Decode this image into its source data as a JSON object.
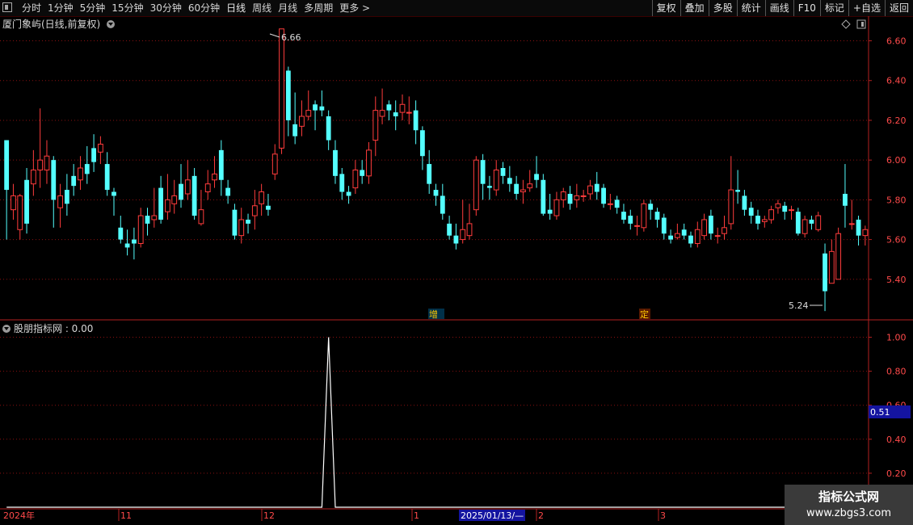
{
  "toolbar": {
    "tabs": [
      {
        "label": "分时"
      },
      {
        "label": "1分钟"
      },
      {
        "label": "5分钟"
      },
      {
        "label": "15分钟"
      },
      {
        "label": "30分钟"
      },
      {
        "label": "60分钟"
      },
      {
        "label": "日线",
        "active": true
      },
      {
        "label": "周线"
      },
      {
        "label": "月线"
      },
      {
        "label": "多周期"
      },
      {
        "label": "更多 >"
      }
    ],
    "right_buttons": [
      {
        "label": "复权"
      },
      {
        "label": "叠加"
      },
      {
        "label": "多股"
      },
      {
        "label": "统计"
      },
      {
        "label": "画线"
      },
      {
        "label": "F10"
      },
      {
        "label": "标记"
      },
      {
        "label": "+自选"
      },
      {
        "label": "返回"
      }
    ]
  },
  "main_panel": {
    "title": "厦门象屿(日线,前复权)",
    "max_label": "6.66",
    "min_label": "5.24",
    "marker_zeng": "增",
    "marker_ding": "定"
  },
  "indicator_panel": {
    "title": "股朋指标网 : 0.00",
    "current_value": "0.51"
  },
  "time_axis": {
    "labels": [
      "2024年",
      "11",
      "12",
      "1",
      "2",
      "3"
    ],
    "cursor_date": "2025/01/13/—"
  },
  "watermark": {
    "line1": "指标公式网",
    "line2": "www.zbgs3.com"
  },
  "colors": {
    "up": "#ff3c3c",
    "down": "#54ffff",
    "grid": "#8a1010",
    "border": "#b42020",
    "axis_text": "#ff4a4a",
    "value_box": "#1414a0"
  },
  "chart_data": [
    {
      "type": "candlestick",
      "title": "厦门象屿(日线,前复权)",
      "ylim": [
        5.2,
        6.72
      ],
      "yticks": [
        5.4,
        5.6,
        5.8,
        6.0,
        6.2,
        6.4,
        6.6
      ],
      "xlabels": [
        "2024年",
        "11",
        "12",
        "1",
        "2",
        "3"
      ],
      "annotations": [
        {
          "text": "6.66",
          "value": 6.66
        },
        {
          "text": "5.24",
          "value": 5.24
        }
      ],
      "candles": [
        [
          6.1,
          5.85,
          6.1,
          5.6
        ],
        [
          5.75,
          5.82,
          5.88,
          5.7
        ],
        [
          5.65,
          5.82,
          5.83,
          5.6
        ],
        [
          5.9,
          5.68,
          5.96,
          5.63
        ],
        [
          5.88,
          5.95,
          6.05,
          5.82
        ],
        [
          5.95,
          6.0,
          6.26,
          5.86
        ],
        [
          5.95,
          6.02,
          6.1,
          5.88
        ],
        [
          6.0,
          5.8,
          6.02,
          5.66
        ],
        [
          5.76,
          5.82,
          5.88,
          5.66
        ],
        [
          5.85,
          5.78,
          5.93,
          5.72
        ],
        [
          5.92,
          5.87,
          5.98,
          5.82
        ],
        [
          5.9,
          5.96,
          6.02,
          5.85
        ],
        [
          5.98,
          5.93,
          6.07,
          5.88
        ],
        [
          6.06,
          5.99,
          6.13,
          5.94
        ],
        [
          6.04,
          6.08,
          6.12,
          5.98
        ],
        [
          5.98,
          5.85,
          6.04,
          5.82
        ],
        [
          5.84,
          5.82,
          5.86,
          5.72
        ],
        [
          5.66,
          5.6,
          5.72,
          5.58
        ],
        [
          5.58,
          5.56,
          5.65,
          5.52
        ],
        [
          5.6,
          5.58,
          5.66,
          5.5
        ],
        [
          5.58,
          5.72,
          5.76,
          5.56
        ],
        [
          5.72,
          5.68,
          5.76,
          5.62
        ],
        [
          5.7,
          5.72,
          5.86,
          5.66
        ],
        [
          5.86,
          5.7,
          5.92,
          5.68
        ],
        [
          5.74,
          5.8,
          5.93,
          5.7
        ],
        [
          5.78,
          5.82,
          5.9,
          5.73
        ],
        [
          5.88,
          5.8,
          5.98,
          5.76
        ],
        [
          5.83,
          5.9,
          6.0,
          5.8
        ],
        [
          5.92,
          5.72,
          5.96,
          5.7
        ],
        [
          5.68,
          5.75,
          5.85,
          5.67
        ],
        [
          5.84,
          5.88,
          5.95,
          5.8
        ],
        [
          5.9,
          5.93,
          6.02,
          5.86
        ],
        [
          6.05,
          5.9,
          6.1,
          5.82
        ],
        [
          5.86,
          5.82,
          5.9,
          5.78
        ],
        [
          5.75,
          5.62,
          5.78,
          5.6
        ],
        [
          5.62,
          5.7,
          5.76,
          5.58
        ],
        [
          5.7,
          5.68,
          5.73,
          5.63
        ],
        [
          5.72,
          5.77,
          5.85,
          5.65
        ],
        [
          5.78,
          5.84,
          5.88,
          5.72
        ],
        [
          5.77,
          5.75,
          5.83,
          5.72
        ],
        [
          5.93,
          6.03,
          6.08,
          5.9
        ],
        [
          6.06,
          6.66,
          6.66,
          6.03
        ],
        [
          6.45,
          6.2,
          6.47,
          6.12
        ],
        [
          6.18,
          6.12,
          6.34,
          6.08
        ],
        [
          6.17,
          6.22,
          6.3,
          6.12
        ],
        [
          6.22,
          6.25,
          6.35,
          6.2
        ],
        [
          6.28,
          6.25,
          6.3,
          6.15
        ],
        [
          6.27,
          6.25,
          6.35,
          6.22
        ],
        [
          6.22,
          6.1,
          6.25,
          6.05
        ],
        [
          6.05,
          5.92,
          6.1,
          5.88
        ],
        [
          5.93,
          5.84,
          5.96,
          5.8
        ],
        [
          5.84,
          5.82,
          5.87,
          5.78
        ],
        [
          5.86,
          5.95,
          6.0,
          5.83
        ],
        [
          5.95,
          5.92,
          6.0,
          5.88
        ],
        [
          5.92,
          6.05,
          6.09,
          5.88
        ],
        [
          6.1,
          6.25,
          6.32,
          6.02
        ],
        [
          6.22,
          6.25,
          6.36,
          6.18
        ],
        [
          6.28,
          6.25,
          6.3,
          6.2
        ],
        [
          6.24,
          6.22,
          6.3,
          6.15
        ],
        [
          6.24,
          6.28,
          6.33,
          6.2
        ],
        [
          6.24,
          6.24,
          6.32,
          6.18
        ],
        [
          6.25,
          6.15,
          6.3,
          6.08
        ],
        [
          6.15,
          6.02,
          6.17,
          5.95
        ],
        [
          5.98,
          5.88,
          6.05,
          5.83
        ],
        [
          5.85,
          5.82,
          5.88,
          5.77
        ],
        [
          5.82,
          5.73,
          5.88,
          5.7
        ],
        [
          5.68,
          5.62,
          5.72,
          5.6
        ],
        [
          5.62,
          5.58,
          5.68,
          5.55
        ],
        [
          5.6,
          5.65,
          5.8,
          5.58
        ],
        [
          5.62,
          5.68,
          5.78,
          5.6
        ],
        [
          5.75,
          6.0,
          6.02,
          5.72
        ],
        [
          6.0,
          5.88,
          6.03,
          5.8
        ],
        [
          5.87,
          5.86,
          5.92,
          5.8
        ],
        [
          5.85,
          5.95,
          6.0,
          5.82
        ],
        [
          5.96,
          5.92,
          5.99,
          5.88
        ],
        [
          5.91,
          5.88,
          5.97,
          5.84
        ],
        [
          5.88,
          5.83,
          5.92,
          5.8
        ],
        [
          5.84,
          5.85,
          5.9,
          5.78
        ],
        [
          5.86,
          5.88,
          5.95,
          5.84
        ],
        [
          5.93,
          5.9,
          6.02,
          5.86
        ],
        [
          5.9,
          5.73,
          5.93,
          5.72
        ],
        [
          5.75,
          5.73,
          5.83,
          5.7
        ],
        [
          5.72,
          5.8,
          5.84,
          5.7
        ],
        [
          5.8,
          5.84,
          5.86,
          5.76
        ],
        [
          5.83,
          5.78,
          5.87,
          5.75
        ],
        [
          5.8,
          5.82,
          5.88,
          5.76
        ],
        [
          5.82,
          5.82,
          5.85,
          5.79
        ],
        [
          5.83,
          5.87,
          5.9,
          5.8
        ],
        [
          5.88,
          5.84,
          5.94,
          5.8
        ],
        [
          5.86,
          5.78,
          5.88,
          5.76
        ],
        [
          5.78,
          5.78,
          5.83,
          5.75
        ],
        [
          5.8,
          5.76,
          5.82,
          5.73
        ],
        [
          5.74,
          5.7,
          5.78,
          5.68
        ],
        [
          5.72,
          5.68,
          5.75,
          5.65
        ],
        [
          5.67,
          5.67,
          5.72,
          5.62
        ],
        [
          5.66,
          5.78,
          5.8,
          5.64
        ],
        [
          5.78,
          5.75,
          5.8,
          5.7
        ],
        [
          5.74,
          5.7,
          5.76,
          5.66
        ],
        [
          5.71,
          5.63,
          5.73,
          5.6
        ],
        [
          5.62,
          5.6,
          5.65,
          5.58
        ],
        [
          5.61,
          5.63,
          5.68,
          5.6
        ],
        [
          5.65,
          5.62,
          5.68,
          5.6
        ],
        [
          5.62,
          5.58,
          5.64,
          5.56
        ],
        [
          5.58,
          5.65,
          5.69,
          5.56
        ],
        [
          5.62,
          5.7,
          5.73,
          5.6
        ],
        [
          5.72,
          5.63,
          5.75,
          5.6
        ],
        [
          5.62,
          5.62,
          5.66,
          5.58
        ],
        [
          5.63,
          5.66,
          5.72,
          5.6
        ],
        [
          5.68,
          5.85,
          6.02,
          5.65
        ],
        [
          5.85,
          5.84,
          5.95,
          5.78
        ],
        [
          5.82,
          5.75,
          5.85,
          5.72
        ],
        [
          5.76,
          5.72,
          5.79,
          5.68
        ],
        [
          5.72,
          5.68,
          5.75,
          5.65
        ],
        [
          5.69,
          5.7,
          5.72,
          5.66
        ],
        [
          5.7,
          5.75,
          5.77,
          5.68
        ],
        [
          5.76,
          5.78,
          5.8,
          5.73
        ],
        [
          5.77,
          5.74,
          5.79,
          5.7
        ],
        [
          5.75,
          5.75,
          5.77,
          5.7
        ],
        [
          5.74,
          5.63,
          5.76,
          5.62
        ],
        [
          5.63,
          5.7,
          5.72,
          5.61
        ],
        [
          5.7,
          5.68,
          5.72,
          5.65
        ],
        [
          5.65,
          5.72,
          5.74,
          5.64
        ],
        [
          5.53,
          5.34,
          5.58,
          5.24
        ],
        [
          5.38,
          5.54,
          5.6,
          5.38
        ],
        [
          5.4,
          5.63,
          5.66,
          5.4
        ],
        [
          5.83,
          5.77,
          5.98,
          5.66
        ],
        [
          5.68,
          5.68,
          5.8,
          5.65
        ],
        [
          5.7,
          5.62,
          5.72,
          5.57
        ],
        [
          5.62,
          5.65,
          5.67,
          5.57
        ]
      ]
    },
    {
      "type": "line",
      "title": "股朋指标网 : 0.00",
      "ylim": [
        0,
        1.05
      ],
      "yticks": [
        0.2,
        0.4,
        0.6,
        0.8,
        1.0
      ],
      "series": [
        {
          "values": [
            0,
            0,
            0,
            0,
            0,
            0,
            0,
            0,
            0,
            0,
            0,
            0,
            0,
            0,
            0,
            0,
            0,
            0,
            0,
            0,
            0,
            0,
            0,
            0,
            0,
            0,
            0,
            0,
            0,
            0,
            0,
            0,
            0,
            0,
            0,
            0,
            0,
            0,
            0,
            0,
            0,
            0,
            0,
            0,
            0,
            0,
            0,
            0,
            0,
            0,
            0,
            0,
            0,
            0,
            0,
            0,
            0,
            0,
            0,
            0,
            0,
            0,
            0,
            0,
            0,
            0,
            0,
            0,
            0,
            0,
            0,
            0,
            0,
            0,
            0,
            0,
            0,
            0,
            0,
            0,
            0,
            0,
            0,
            0,
            0,
            0,
            0,
            0,
            0,
            0,
            0,
            0,
            0,
            0,
            0,
            0,
            0,
            0,
            0,
            0,
            0,
            0,
            0,
            0,
            0,
            0,
            0,
            0,
            0,
            0,
            0,
            0,
            0,
            0,
            0,
            0,
            0,
            0,
            0,
            0,
            0,
            0,
            0,
            0,
            0,
            0,
            0,
            0,
            0,
            0,
            0,
            0,
            0,
            0,
            0,
            0,
            0,
            0
          ]
        }
      ],
      "pulse": {
        "index": 48,
        "value": 1.0
      }
    }
  ]
}
